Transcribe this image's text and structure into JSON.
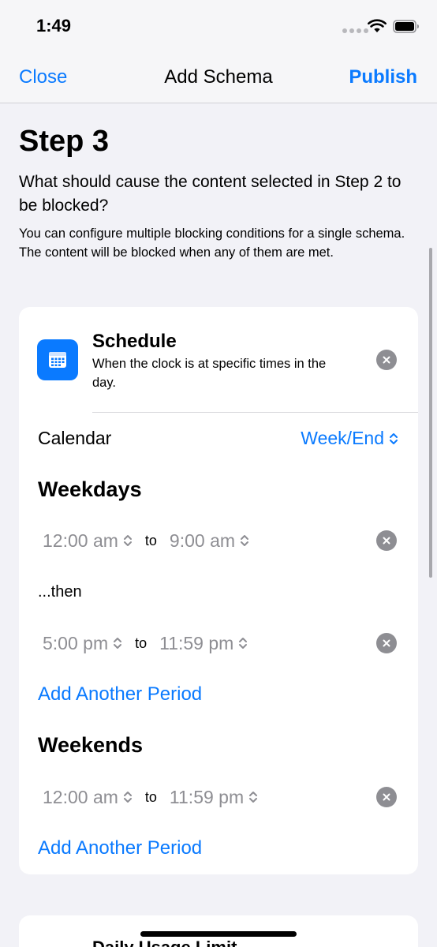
{
  "status_bar": {
    "time": "1:49",
    "icons": [
      "cellular-icon",
      "wifi-icon",
      "battery-icon"
    ]
  },
  "nav": {
    "close_label": "Close",
    "title": "Add Schema",
    "publish_label": "Publish"
  },
  "step": {
    "title": "Step 3",
    "question": "What should cause the content selected in Step 2 to be blocked?",
    "description": "You can configure multiple blocking conditions for a single schema. The content will be blocked when any of them are met."
  },
  "schedule_card": {
    "icon": "calendar-icon",
    "title": "Schedule",
    "subtitle": "When the clock is at specific times in the day.",
    "calendar_label": "Calendar",
    "calendar_value": "Week/End",
    "weekdays": {
      "title": "Weekdays",
      "periods": [
        {
          "from": "12:00 am",
          "to_label": "to",
          "to": "9:00 am"
        },
        {
          "from": "5:00 pm",
          "to_label": "to",
          "to": "11:59 pm"
        }
      ],
      "then_label": "...then",
      "add_label": "Add Another Period"
    },
    "weekends": {
      "title": "Weekends",
      "periods": [
        {
          "from": "12:00 am",
          "to_label": "to",
          "to": "11:59 pm"
        }
      ],
      "add_label": "Add Another Period"
    }
  },
  "next_card": {
    "title": "Daily Usage Limit"
  },
  "colors": {
    "accent": "#0a7aff",
    "background": "#f2f2f7",
    "card": "#ffffff",
    "muted": "#8e8e93"
  }
}
